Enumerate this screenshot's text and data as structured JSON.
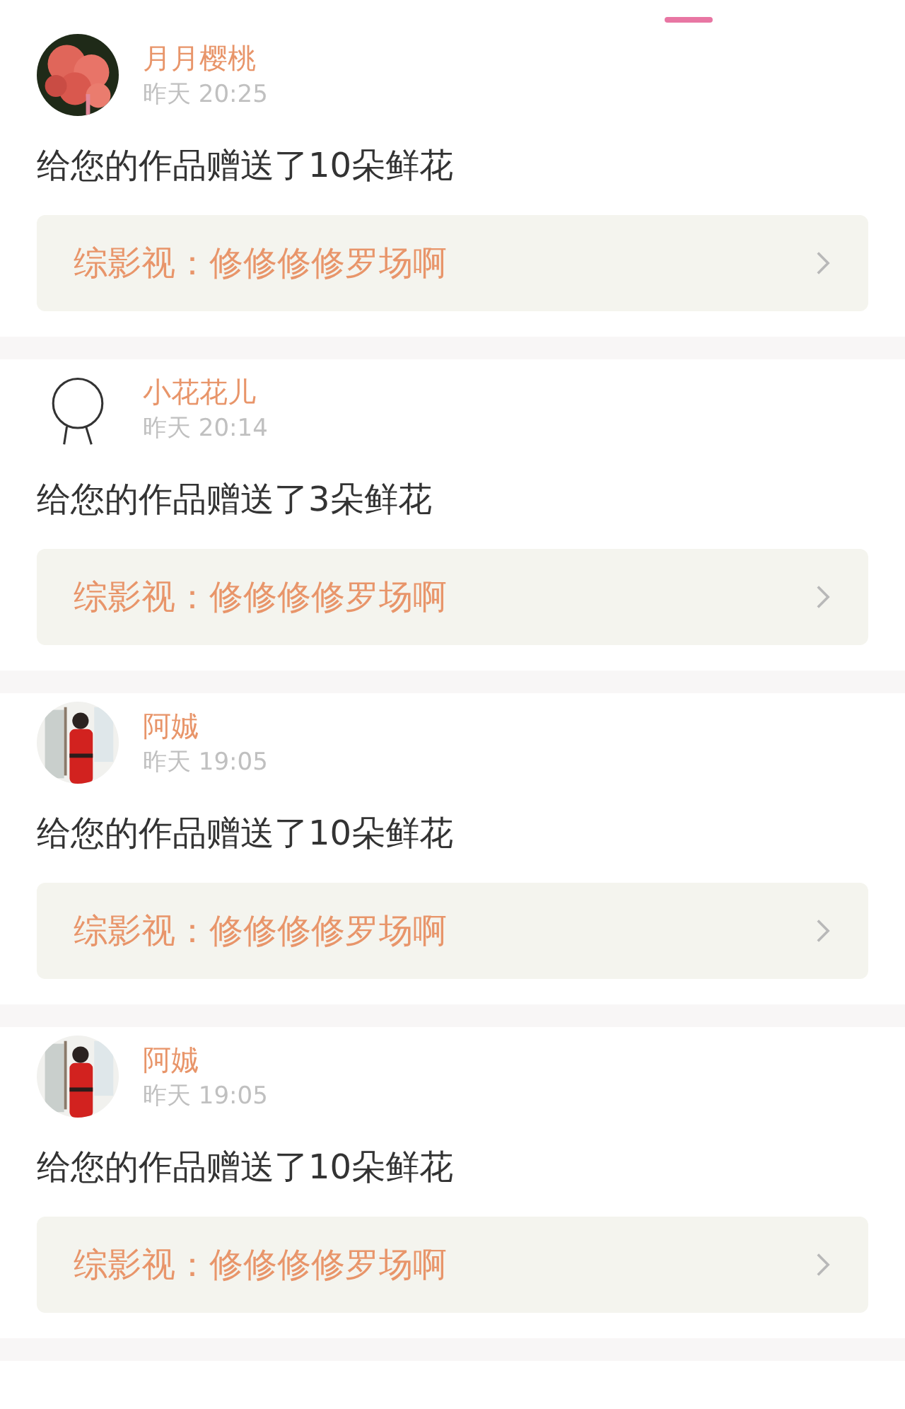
{
  "notifications": [
    {
      "name": "月月樱桃",
      "time": "昨天 20:25",
      "message": "给您的作品赠送了10朵鲜花",
      "work": "综影视：修修修修罗场啊"
    },
    {
      "avatar": {
        "kind": "drawing"
      },
      "name": "小花花儿",
      "time": "昨天 20:14",
      "message": "给您的作品赠送了3朵鲜花",
      "work": "综影视：修修修修罗场啊"
    },
    {
      "name": "阿娍",
      "time": "昨天 19:05",
      "message": "给您的作品赠送了10朵鲜花",
      "work": "综影视：修修修修罗场啊"
    },
    {
      "name": "阿娍",
      "time": "昨天 19:05",
      "message": "给您的作品赠送了10朵鲜花",
      "work": "综影视：修修修修罗场啊"
    }
  ]
}
